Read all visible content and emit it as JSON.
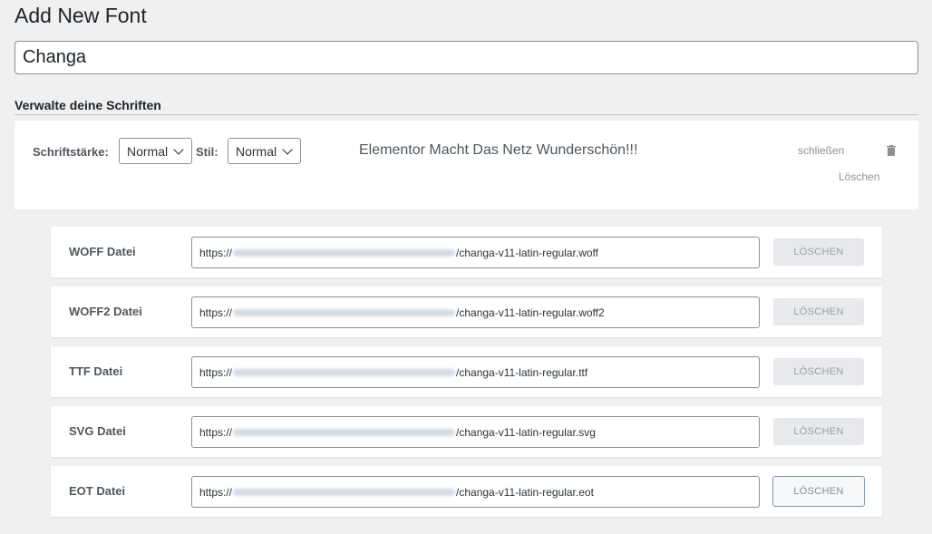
{
  "page": {
    "title": "Add New Font"
  },
  "font_name": {
    "value": "Changa"
  },
  "manage": {
    "heading": "Verwalte deine Schriften",
    "weight_label": "Schriftstärke:",
    "weight_value": "Normal",
    "style_label": "Stil:",
    "style_value": "Normal",
    "preview_text": "Elementor Macht Das Netz Wunderschön!!!",
    "close_label": "schließen",
    "delete_label": "Löschen"
  },
  "files": [
    {
      "label": "WOFF Datei",
      "url_prefix": "https://",
      "url_suffix": "/changa-v11-latin-regular.woff",
      "button": "LÖSCHEN"
    },
    {
      "label": "WOFF2 Datei",
      "url_prefix": "https://",
      "url_suffix": "/changa-v11-latin-regular.woff2",
      "button": "LÖSCHEN"
    },
    {
      "label": "TTF Datei",
      "url_prefix": "https://",
      "url_suffix": "/changa-v11-latin-regular.ttf",
      "button": "LÖSCHEN"
    },
    {
      "label": "SVG Datei",
      "url_prefix": "https://",
      "url_suffix": "/changa-v11-latin-regular.svg",
      "button": "LÖSCHEN"
    },
    {
      "label": "EOT Datei",
      "url_prefix": "https://",
      "url_suffix": "/changa-v11-latin-regular.eot",
      "button": "LÖSCHEN"
    }
  ],
  "icons": {
    "trash": "trash-icon",
    "dropdown": "chevron-down-icon"
  },
  "colors": {
    "background": "#f0f0f1",
    "panel": "#ffffff",
    "button_disabled": "#e8e9ec",
    "button_focus_border": "#7f96b3"
  }
}
